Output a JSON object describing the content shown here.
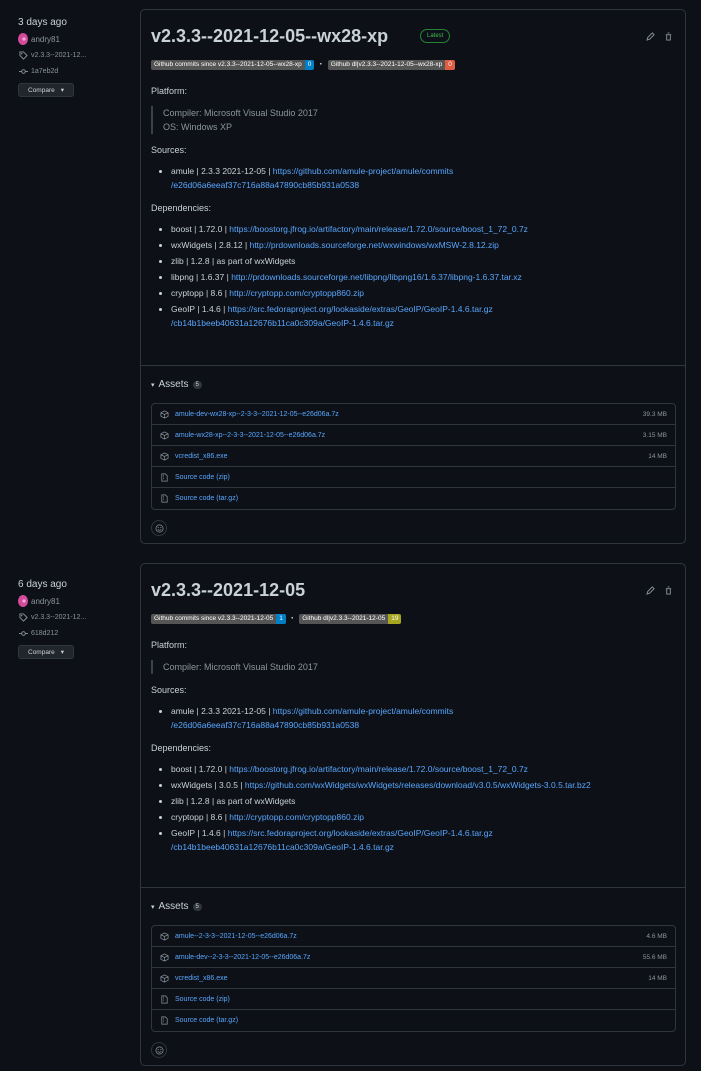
{
  "releases": [
    {
      "date": "3 days ago",
      "user": "andry81",
      "tag": "v2.3.3--2021-12...",
      "commit": "1a7eb2d",
      "compare_label": "Compare",
      "title": "v2.3.3--2021-12-05--wx28-xp",
      "latest_label": "Latest",
      "badges": [
        {
          "label": "Github commits since v2.3.3--2021-12-05--wx28-xp",
          "value": "0",
          "color": "#007ec6"
        },
        {
          "label": "Github dl|v2.3.3--2021-12-05--wx28-xp",
          "value": "0",
          "color": "#e05d44"
        }
      ],
      "platform_label": "Platform:",
      "platform_lines": [
        "Compiler: Microsoft Visual Studio 2017",
        "OS: Windows XP"
      ],
      "sources_label": "Sources:",
      "sources": [
        {
          "text": "amule | 2.3.3 2021-12-05 | ",
          "link": "https://github.com/amule-project/amule/commits",
          "link2": "/e26d06a6eeaf37c716a88a47890cb85b931a0538"
        }
      ],
      "deps_label": "Dependencies:",
      "deps": [
        {
          "text": "boost | 1.72.0 | ",
          "link": "https://boostorg.jfrog.io/artifactory/main/release/1.72.0/source/boost_1_72_0.7z",
          "link2": ""
        },
        {
          "text": "wxWidgets | 2.8.12 | ",
          "link": "http://prdownloads.sourceforge.net/wxwindows/wxMSW-2.8.12.zip",
          "link2": ""
        },
        {
          "text": "zlib | 1.2.8 | as part of wxWidgets",
          "link": "",
          "link2": ""
        },
        {
          "text": "libpng | 1.6.37 | ",
          "link": "http://prdownloads.sourceforge.net/libpng/libpng16/1.6.37/libpng-1.6.37.tar.xz",
          "link2": ""
        },
        {
          "text": "cryptopp | 8.6 | ",
          "link": "http://cryptopp.com/cryptopp860.zip",
          "link2": ""
        },
        {
          "text": "GeoIP | 1.4.6 | ",
          "link": "https://src.fedoraproject.org/lookaside/extras/GeoIP/GeoIP-1.4.6.tar.gz",
          "link2": "/cb14b1beeb40631a12676b11ca0c309a/GeoIP-1.4.6.tar.gz"
        }
      ],
      "assets_label": "Assets",
      "assets_count": "5",
      "assets": [
        {
          "name": "amule-dev-wx28-xp--2-3-3--2021-12-05--e26d06a.7z",
          "size": "39.3 MB",
          "icon": "package-icon"
        },
        {
          "name": "amule-wx28-xp--2-3-3--2021-12-05--e26d06a.7z",
          "size": "3.15 MB",
          "icon": "package-icon"
        },
        {
          "name": "vcredist_x86.exe",
          "size": "14 MB",
          "icon": "package-icon"
        },
        {
          "name": "Source code  (zip)",
          "size": "",
          "icon": "file-zip-icon"
        },
        {
          "name": "Source code  (tar.gz)",
          "size": "",
          "icon": "file-zip-icon"
        }
      ]
    },
    {
      "date": "6 days ago",
      "user": "andry81",
      "tag": "v2.3.3--2021-12...",
      "commit": "618d212",
      "compare_label": "Compare",
      "title": "v2.3.3--2021-12-05",
      "latest_label": "",
      "badges": [
        {
          "label": "Github commits since v2.3.3--2021-12-05",
          "value": "1",
          "color": "#007ec6"
        },
        {
          "label": "Github dl|v2.3.3--2021-12-05",
          "value": "19",
          "color": "#a4a61d"
        }
      ],
      "platform_label": "Platform:",
      "platform_lines": [
        "Compiler: Microsoft Visual Studio 2017"
      ],
      "sources_label": "Sources:",
      "sources": [
        {
          "text": "amule | 2.3.3 2021-12-05 | ",
          "link": "https://github.com/amule-project/amule/commits",
          "link2": "/e26d06a6eeaf37c716a88a47890cb85b931a0538"
        }
      ],
      "deps_label": "Dependencies:",
      "deps": [
        {
          "text": "boost | 1.72.0 | ",
          "link": "https://boostorg.jfrog.io/artifactory/main/release/1.72.0/source/boost_1_72_0.7z",
          "link2": ""
        },
        {
          "text": "wxWidgets | 3.0.5 | ",
          "link": "https://github.com/wxWidgets/wxWidgets/releases/download/v3.0.5/wxWidgets-3.0.5.tar.bz2",
          "link2": ""
        },
        {
          "text": "zlib | 1.2.8 | as part of wxWidgets",
          "link": "",
          "link2": ""
        },
        {
          "text": "cryptopp | 8.6 | ",
          "link": "http://cryptopp.com/cryptopp860.zip",
          "link2": ""
        },
        {
          "text": "GeoIP | 1.4.6 | ",
          "link": "https://src.fedoraproject.org/lookaside/extras/GeoIP/GeoIP-1.4.6.tar.gz",
          "link2": "/cb14b1beeb40631a12676b11ca0c309a/GeoIP-1.4.6.tar.gz"
        }
      ],
      "assets_label": "Assets",
      "assets_count": "5",
      "assets": [
        {
          "name": "amule--2-3-3--2021-12-05--e26d06a.7z",
          "size": "4.6 MB",
          "icon": "package-icon"
        },
        {
          "name": "amule-dev--2-3-3--2021-12-05--e26d06a.7z",
          "size": "55.6 MB",
          "icon": "package-icon"
        },
        {
          "name": "vcredist_x86.exe",
          "size": "14 MB",
          "icon": "package-icon"
        },
        {
          "name": "Source code  (zip)",
          "size": "",
          "icon": "file-zip-icon"
        },
        {
          "name": "Source code  (tar.gz)",
          "size": "",
          "icon": "file-zip-icon"
        }
      ]
    }
  ]
}
